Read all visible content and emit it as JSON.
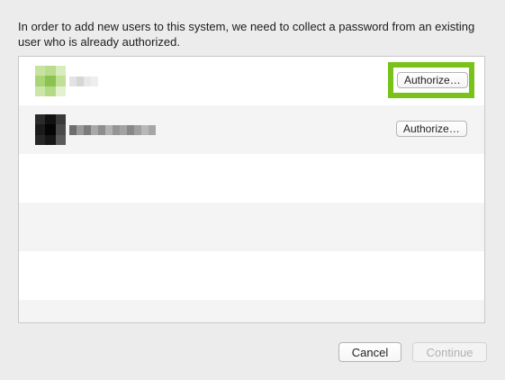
{
  "dialog": {
    "message": "In order to add new users to this system, we need to collect a password from an existing user who is already authorized."
  },
  "users": [
    {
      "authorize_label": "Authorize…"
    },
    {
      "authorize_label": "Authorize…"
    }
  ],
  "footer": {
    "cancel_label": "Cancel",
    "continue_label": "Continue"
  },
  "colors": {
    "highlight": "#78c21a",
    "list_background": "#ffffff",
    "row_alt": "#f4f4f4"
  }
}
